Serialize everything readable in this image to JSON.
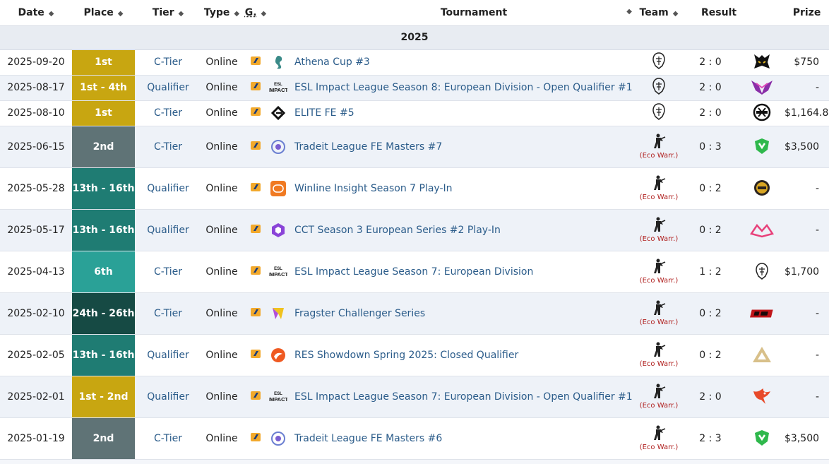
{
  "headers": {
    "date": "Date",
    "place": "Place",
    "tier": "Tier",
    "type": "Type",
    "game": "G.",
    "tournament": "Tournament",
    "team": "Team",
    "result": "Result",
    "prize": "Prize"
  },
  "year_label": "2025",
  "team_eco_label": "(Eco Warr.)",
  "rows": [
    {
      "date": "2025-09-20",
      "place": "1st",
      "tier": "C-Tier",
      "type": "Online",
      "tournament": "Athena Cup #3",
      "result": "2 : 0",
      "prize": "$750",
      "place_color": "gold",
      "team": "BIG",
      "opponent_icon": "gold-fox-icon"
    },
    {
      "date": "2025-08-17",
      "place": "1st - 4th",
      "tier": "Qualifier",
      "type": "Online",
      "tournament": "ESL Impact League Season 8: European Division - Open Qualifier #1",
      "result": "2 : 0",
      "prize": "-",
      "place_color": "gold",
      "team": "BIG",
      "opponent_icon": "purple-wing-icon"
    },
    {
      "date": "2025-08-10",
      "place": "1st",
      "tier": "C-Tier",
      "type": "Online",
      "tournament": "ELITE FE #5",
      "result": "2 : 0",
      "prize": "$1,164.82",
      "place_color": "gold",
      "team": "BIG",
      "opponent_icon": "ninja-icon"
    },
    {
      "date": "2025-06-15",
      "place": "2nd",
      "tier": "C-Tier",
      "type": "Online",
      "tournament": "Tradeit League FE Masters #7",
      "result": "0 : 3",
      "prize": "$3,500",
      "place_color": "silver",
      "team": "eco",
      "opponent_icon": "green-shield-icon"
    },
    {
      "date": "2025-05-28",
      "place": "13th - 16th",
      "tier": "Qualifier",
      "type": "Online",
      "tournament": "Winline Insight Season 7 Play-In",
      "result": "0 : 2",
      "prize": "-",
      "place_color": "teal1",
      "team": "eco",
      "opponent_icon": "gold-badge-icon"
    },
    {
      "date": "2025-05-17",
      "place": "13th - 16th",
      "tier": "Qualifier",
      "type": "Online",
      "tournament": "CCT Season 3 European Series #2 Play-In",
      "result": "0 : 2",
      "prize": "-",
      "place_color": "teal1",
      "team": "eco",
      "opponent_icon": "pink-crown-icon"
    },
    {
      "date": "2025-04-13",
      "place": "6th",
      "tier": "C-Tier",
      "type": "Online",
      "tournament": "ESL Impact League Season 7: European Division",
      "result": "1 : 2",
      "prize": "$1,700",
      "place_color": "teal2",
      "team": "eco",
      "opponent_icon": "big-icon"
    },
    {
      "date": "2025-02-10",
      "place": "24th - 26th",
      "tier": "C-Tier",
      "type": "Online",
      "tournament": "Fragster Challenger Series",
      "result": "0 : 2",
      "prize": "-",
      "place_color": "teal3",
      "team": "eco",
      "opponent_icon": "red-banner-icon"
    },
    {
      "date": "2025-02-05",
      "place": "13th - 16th",
      "tier": "Qualifier",
      "type": "Online",
      "tournament": "RES Showdown Spring 2025: Closed Qualifier",
      "result": "0 : 2",
      "prize": "-",
      "place_color": "teal1",
      "team": "eco",
      "opponent_icon": "triangle-logo-icon"
    },
    {
      "date": "2025-02-01",
      "place": "1st - 2nd",
      "tier": "Qualifier",
      "type": "Online",
      "tournament": "ESL Impact League Season 7: European Division - Open Qualifier #1",
      "result": "2 : 0",
      "prize": "-",
      "place_color": "gold",
      "team": "eco",
      "opponent_icon": "phoenix-icon"
    },
    {
      "date": "2025-01-19",
      "place": "2nd",
      "tier": "C-Tier",
      "type": "Online",
      "tournament": "Tradeit League FE Masters #6",
      "result": "2 : 3",
      "prize": "$3,500",
      "place_color": "silver",
      "team": "eco",
      "opponent_icon": "green-shield-icon"
    }
  ],
  "tournament_icons": [
    "seahorse-icon",
    "esl-impact-icon",
    "elite-icon",
    "tradeit-icon",
    "winline-icon",
    "cct-icon",
    "esl-impact-icon",
    "fragster-icon",
    "res-icon",
    "esl-impact-icon",
    "tradeit-icon"
  ],
  "colors": {
    "gold": "#c8a611",
    "silver": "#5f7376",
    "teal1": "#1f7c73",
    "teal2": "#2aa197",
    "teal3": "#164a44",
    "link": "#2b5c8a",
    "eco": "#b0201f"
  }
}
